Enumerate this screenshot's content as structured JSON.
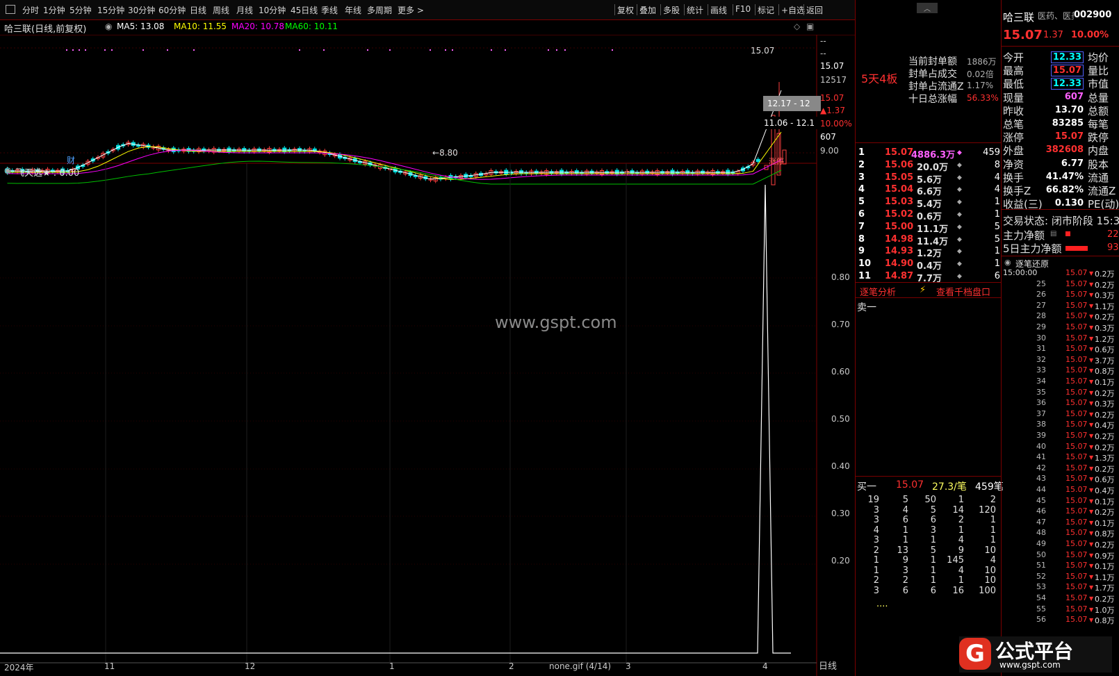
{
  "toolbar": {
    "periods": [
      "分时",
      "1分钟",
      "5分钟",
      "15分钟",
      "30分钟",
      "60分钟",
      "日线",
      "周线",
      "月线",
      "10分钟",
      "45日线",
      "季线",
      "年线",
      "多周期",
      "更多 >"
    ],
    "tools": [
      "复权",
      "叠加",
      "多股",
      "统计",
      "画线",
      "F10",
      "标记",
      "+自选",
      "返回"
    ]
  },
  "chart_header": {
    "title": "哈三联(日线,前复权)",
    "ma5": "MA5: 13.08",
    "ma10": "MA10: 11.55",
    "ma20": "MA20: 10.78",
    "ma60": "MA60: 10.11",
    "colors": {
      "ma5": "#ffffff",
      "ma10": "#ffff00",
      "ma20": "#ff00ff",
      "ma60": "#00ff00"
    }
  },
  "candle_panel": {
    "high_label": "15.07",
    "low_label": "8.80",
    "cursor_label_1": "12.17 - 12",
    "cursor_label_2": "11.06 - 12.1",
    "cai_tag": "财",
    "zhangting_tag": "涨停",
    "price_axis": [
      "--",
      "--",
      "15.07",
      "12517",
      "15.07",
      "▲1.37",
      "10.00%",
      "607",
      "9.00"
    ]
  },
  "indicator_panel": {
    "name": "飞天选★ : 0.00",
    "y_ticks": [
      "0.80",
      "0.70",
      "0.60",
      "0.50",
      "0.40",
      "0.30",
      "0.20"
    ],
    "x_labels": [
      "2024年",
      "11",
      "12",
      "1",
      "2",
      "3",
      "4"
    ],
    "x_axis_unit": "日线",
    "watermark": "www.gspt.com",
    "file_caption": "none.gif (4/14)"
  },
  "seal_panel": {
    "streak": "5天4板",
    "rows": [
      {
        "label": "当前封单额",
        "value": "1886万"
      },
      {
        "label": "封单占成交",
        "value": "0.02倍"
      },
      {
        "label": "封单占流通Z",
        "value": "1.17%"
      },
      {
        "label": "十日总涨幅",
        "value": "56.33%"
      }
    ]
  },
  "order_book": {
    "buy_levels": [
      {
        "n": "1",
        "price": "15.07",
        "vol": "4886.3万",
        "cnt": "459"
      },
      {
        "n": "2",
        "price": "15.06",
        "vol": "20.0万",
        "cnt": "8"
      },
      {
        "n": "3",
        "price": "15.05",
        "vol": "5.6万",
        "cnt": "4"
      },
      {
        "n": "4",
        "price": "15.04",
        "vol": "6.6万",
        "cnt": "4"
      },
      {
        "n": "5",
        "price": "15.03",
        "vol": "5.4万",
        "cnt": "1"
      },
      {
        "n": "6",
        "price": "15.02",
        "vol": "0.6万",
        "cnt": "1"
      },
      {
        "n": "7",
        "price": "15.00",
        "vol": "11.1万",
        "cnt": "5"
      },
      {
        "n": "8",
        "price": "14.98",
        "vol": "11.4万",
        "cnt": "5"
      },
      {
        "n": "9",
        "price": "14.93",
        "vol": "1.2万",
        "cnt": "1"
      },
      {
        "n": "10",
        "price": "14.90",
        "vol": "0.4万",
        "cnt": "1"
      },
      {
        "n": "11",
        "price": "14.87",
        "vol": "7.7万",
        "cnt": "6"
      }
    ],
    "links": {
      "analysis": "逐笔分析",
      "qiandang": "查看千档盘口"
    },
    "sell_one_label": "卖一",
    "buy_one": {
      "label": "买一",
      "price": "15.07",
      "vol": "27.3/笔",
      "count": "459笔"
    },
    "queue": [
      [
        "19",
        "5",
        "50",
        "1",
        "2"
      ],
      [
        "3",
        "4",
        "5",
        "14",
        "120"
      ],
      [
        "3",
        "6",
        "6",
        "2",
        "1"
      ],
      [
        "4",
        "1",
        "3",
        "1",
        "1"
      ],
      [
        "3",
        "1",
        "1",
        "4",
        "1"
      ],
      [
        "2",
        "13",
        "5",
        "9",
        "10"
      ],
      [
        "1",
        "9",
        "1",
        "145",
        "4"
      ],
      [
        "1",
        "3",
        "1",
        "4",
        "10"
      ],
      [
        "2",
        "2",
        "1",
        "1",
        "10"
      ],
      [
        "3",
        "6",
        "6",
        "16",
        "100"
      ]
    ],
    "queue_more": "...."
  },
  "quote": {
    "name": "哈三联",
    "industry": "医药、医美",
    "code": "002900",
    "price": "15.07",
    "change": "1.37",
    "pct": "10.00%",
    "rows": [
      {
        "l": "今开",
        "v": "12.33",
        "r": "均价",
        "vc": "#00ffff",
        "box": true
      },
      {
        "l": "最高",
        "v": "15.07",
        "r": "量比",
        "vc": "#ff3030",
        "box": true
      },
      {
        "l": "最低",
        "v": "12.33",
        "r": "市值",
        "vc": "#00ffff",
        "box": true
      },
      {
        "l": "现量",
        "v": "607",
        "r": "总量",
        "vc": "#ff60ff",
        "box": false
      },
      {
        "l": "昨收",
        "v": "13.70",
        "r": "总额",
        "vc": "#ffffff",
        "box": false
      },
      {
        "l": "总笔",
        "v": "83285",
        "r": "每笔",
        "vc": "#ffffff",
        "box": false
      },
      {
        "l": "涨停",
        "v": "15.07",
        "r": "跌停",
        "vc": "#ff3030",
        "box": false
      },
      {
        "l": "外盘",
        "v": "382608",
        "r": "内盘",
        "vc": "#ff3030",
        "box": false
      },
      {
        "l": "净资",
        "v": "6.77",
        "r": "股本",
        "vc": "#ffffff",
        "box": false
      },
      {
        "l": "换手",
        "v": "41.47%",
        "r": "流通",
        "vc": "#ffffff",
        "box": false
      },
      {
        "l": "换手Z",
        "v": "66.82%",
        "r": "流通Z",
        "vc": "#ffffff",
        "box": false
      },
      {
        "l": "收益(三)",
        "v": "0.130",
        "r": "PE(动)",
        "vc": "#ffffff",
        "box": false
      }
    ],
    "trade_status": "交易状态: 闭市阶段 15:3",
    "main_net": "主力净额",
    "main_net_value": "22",
    "main_net5": "5日主力净额",
    "main_net5_value": "93"
  },
  "ticks": {
    "title": "逐笔还原",
    "first_time": "15:00:00",
    "price": "15.07",
    "rows": [
      {
        "t": "",
        "v": "0.2万"
      },
      {
        "t": "25",
        "v": "0.2万"
      },
      {
        "t": "26",
        "v": "0.3万"
      },
      {
        "t": "27",
        "v": "1.1万"
      },
      {
        "t": "28",
        "v": "0.2万"
      },
      {
        "t": "29",
        "v": "0.3万"
      },
      {
        "t": "30",
        "v": "1.2万"
      },
      {
        "t": "31",
        "v": "0.6万"
      },
      {
        "t": "32",
        "v": "3.7万"
      },
      {
        "t": "33",
        "v": "0.8万"
      },
      {
        "t": "34",
        "v": "0.1万"
      },
      {
        "t": "35",
        "v": "0.2万"
      },
      {
        "t": "36",
        "v": "0.3万"
      },
      {
        "t": "37",
        "v": "0.2万"
      },
      {
        "t": "38",
        "v": "0.4万"
      },
      {
        "t": "39",
        "v": "0.2万"
      },
      {
        "t": "40",
        "v": "0.2万"
      },
      {
        "t": "41",
        "v": "1.3万"
      },
      {
        "t": "42",
        "v": "0.2万"
      },
      {
        "t": "43",
        "v": "0.6万"
      },
      {
        "t": "44",
        "v": "0.4万"
      },
      {
        "t": "45",
        "v": "0.1万"
      },
      {
        "t": "46",
        "v": "0.2万"
      },
      {
        "t": "47",
        "v": "0.1万"
      },
      {
        "t": "48",
        "v": "0.8万"
      },
      {
        "t": "49",
        "v": "0.2万"
      },
      {
        "t": "50",
        "v": "0.9万"
      },
      {
        "t": "51",
        "v": "0.1万"
      },
      {
        "t": "52",
        "v": "1.1万"
      },
      {
        "t": "53",
        "v": "1.7万"
      },
      {
        "t": "54",
        "v": "0.2万"
      },
      {
        "t": "55",
        "v": "1.0万"
      },
      {
        "t": "56",
        "v": "0.8万"
      }
    ]
  },
  "logo": {
    "text": "公式平台",
    "url_text": "www.gspt.com"
  }
}
